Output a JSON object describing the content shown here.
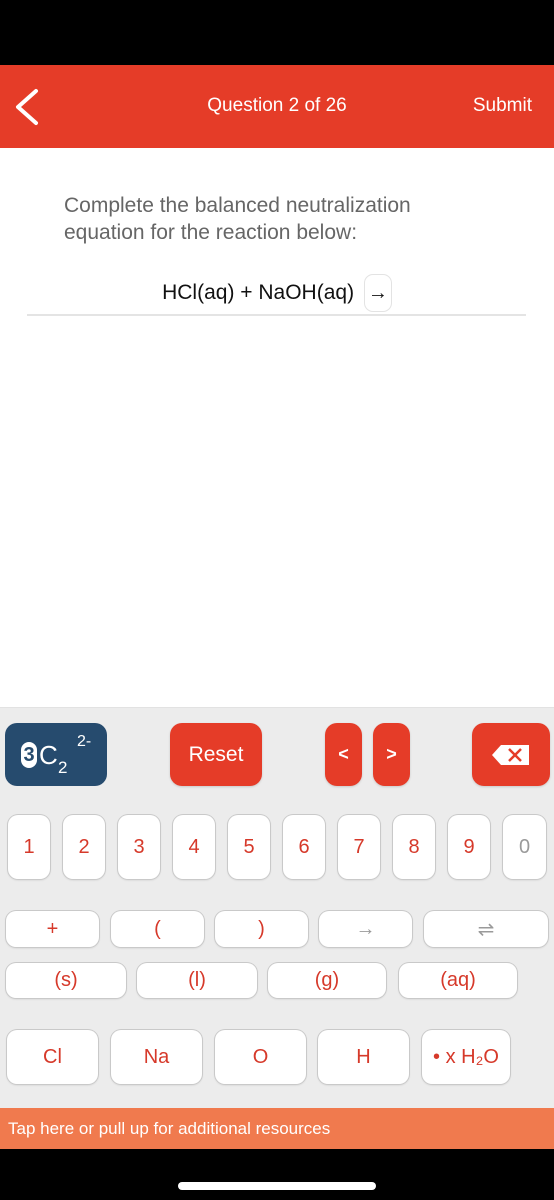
{
  "header": {
    "title": "Question 2 of 26",
    "submit_label": "Submit",
    "back_icon": "chevron-left-icon",
    "color": "#e53c28"
  },
  "question": {
    "prompt": "Complete the balanced neutralization equation for the reaction below:",
    "equation": "HCl(aq) + NaOH(aq)",
    "arrow": "→",
    "answer_value": ""
  },
  "keyboard": {
    "element_key": {
      "coefficient": "3",
      "symbol": "C",
      "subscript": "2",
      "charge": "2-"
    },
    "reset_label": "Reset",
    "cursor_left_label": "<",
    "cursor_right_label": ">",
    "backspace_icon": "backspace-icon",
    "digits": [
      "1",
      "2",
      "3",
      "4",
      "5",
      "6",
      "7",
      "8",
      "9",
      "0"
    ],
    "operators": [
      "+",
      "(",
      ")",
      "→",
      "⇌"
    ],
    "states": [
      "(s)",
      "(l)",
      "(g)",
      "(aq)"
    ],
    "elements": [
      "Cl",
      "Na",
      "O",
      "H",
      "• x H₂O"
    ]
  },
  "resources_bar": {
    "label": "Tap here or pull up for additional resources",
    "color": "#f07a4e"
  }
}
